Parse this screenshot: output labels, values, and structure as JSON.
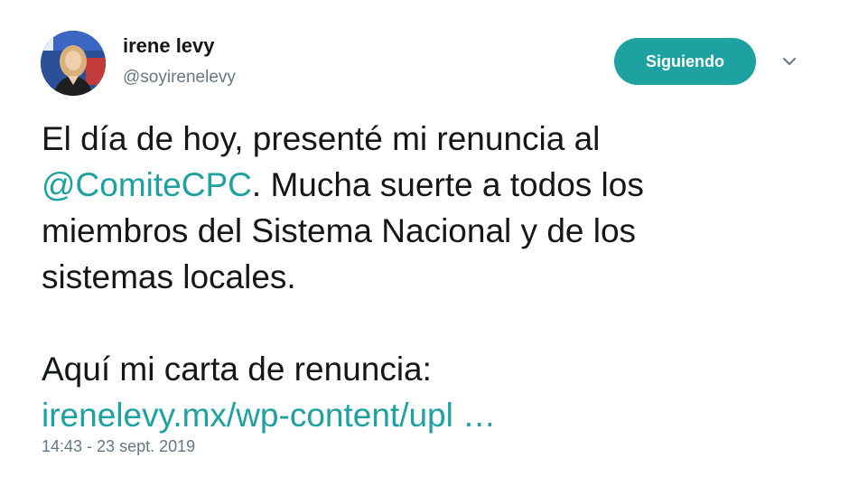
{
  "colors": {
    "accent": "#1da1a1",
    "text": "#14171a",
    "muted": "#657786"
  },
  "author": {
    "name": "irene levy",
    "handle": "@soyirenelevy",
    "avatar_icon": "profile-photo"
  },
  "actions": {
    "follow_label": "Siguiendo",
    "menu_icon": "chevron-down-icon"
  },
  "tweet": {
    "line1": "El día de hoy, presenté mi renuncia al",
    "mention": "@ComiteCPC",
    "line2_rest": ". Mucha suerte a todos los",
    "line3": "miembros del Sistema Nacional y de los",
    "line4": "sistemas locales.",
    "line5": "Aquí mi carta de renuncia:",
    "link": "irenelevy.mx/wp-content/upl …",
    "timestamp": "14:43 - 23 sept. 2019"
  }
}
